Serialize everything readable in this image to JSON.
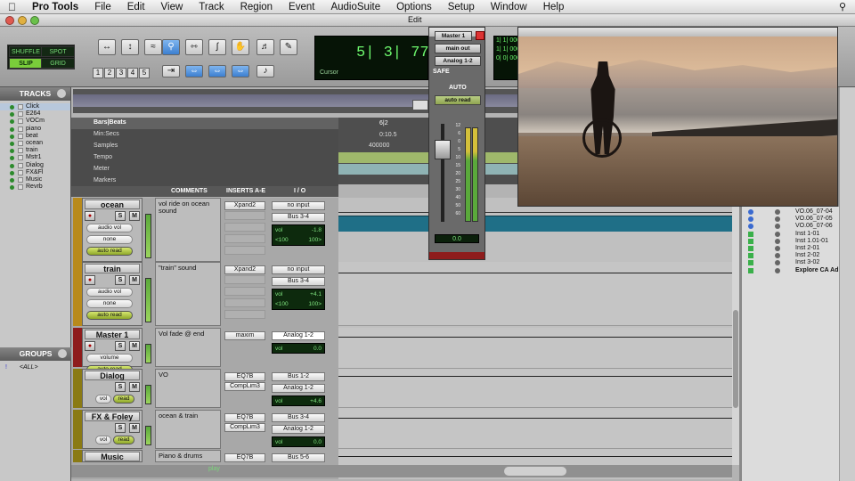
{
  "menubar": {
    "app": "Pro Tools",
    "items": [
      "File",
      "Edit",
      "View",
      "Track",
      "Region",
      "Event",
      "AudioSuite",
      "Options",
      "Setup",
      "Window",
      "Help"
    ]
  },
  "window": {
    "edit_title": "Edit"
  },
  "modes": {
    "shuffle": "SHUFFLE",
    "spot": "SPOT",
    "slip": "SLIP",
    "grid": "GRID"
  },
  "zoom_presets": [
    "1",
    "2",
    "3",
    "4",
    "5"
  ],
  "counter": {
    "main": "5| 3| 774",
    "label": "Cursor",
    "mini1": "1| 1| 000",
    "mini2": "1| 1| 000",
    "mini3": "0| 0| 000"
  },
  "tracks_panel": {
    "header": "TRACKS",
    "items": [
      "Click",
      "E264",
      "VOCm",
      "piano",
      "beat",
      "ocean",
      "train",
      "Mstr1",
      "Dialog",
      "FX&Fl",
      "Music",
      "Revrb"
    ]
  },
  "groups_panel": {
    "header": "GROUPS",
    "item": "<ALL>",
    "marker": "!"
  },
  "rulers": {
    "barsbeats": "Bars|Beats",
    "barsbeats_val": "6|2",
    "minsecs": "Min:Secs",
    "minsecs_val": "0:10.5",
    "samples": "Samples",
    "samples_val": "400000",
    "tempo": "Tempo",
    "meter": "Meter",
    "markers": "Markers"
  },
  "columns": {
    "comments": "COMMENTS",
    "inserts": "INSERTS A-E",
    "io": "I / O"
  },
  "strips": [
    {
      "name": "ocean",
      "automation": "audio vol",
      "group": "none",
      "mode": "auto read",
      "comment": "vol ride on ocean sound",
      "inserts": [
        "Xpand2"
      ],
      "input": "no input",
      "output": "Bus 3-4",
      "vol": "vol",
      "vol_val": "-1.8",
      "pan_l": "<100",
      "pan_r": "100>"
    },
    {
      "name": "train",
      "automation": "audio vol",
      "group": "none",
      "mode": "auto read",
      "comment": "\"train\" sound",
      "inserts": [
        "Xpand2"
      ],
      "input": "no input",
      "output": "Bus 3-4",
      "vol": "vol",
      "vol_val": "+4.1",
      "pan_l": "<100",
      "pan_r": "100>"
    },
    {
      "name": "Master 1",
      "automation": "volume",
      "mode": "auto read",
      "comment": "Vol fade @ end",
      "inserts": [
        "maxim"
      ],
      "output": "Analog 1-2",
      "vol": "vol",
      "vol_val": "0.0"
    },
    {
      "name": "Dialog",
      "vol": "vol",
      "mode": "read",
      "comment": "VO",
      "inserts": [
        "EQ7B",
        "CompLim3"
      ],
      "input": "Bus 1-2",
      "output": "Analog 1-2",
      "vol_val": "+4.6",
      "pan": "P"
    },
    {
      "name": "FX & Foley",
      "vol": "vol",
      "mode": "read",
      "comment": "ocean & train",
      "inserts": [
        "EQ7B",
        "CompLim3"
      ],
      "input": "Bus 3-4",
      "output": "Analog 1-2",
      "vol_val": "0.0",
      "pan": "P"
    },
    {
      "name": "Music",
      "comment": "Piano & drums",
      "inserts": [
        "EQ7B"
      ],
      "input": "Bus 5-6"
    }
  ],
  "buttons": {
    "s": "S",
    "m": "M"
  },
  "status": {
    "play": "play"
  },
  "mixer": {
    "name": "Master 1",
    "out": "main out",
    "analog": "Analog 1-2",
    "safe": "SAFE",
    "auto": "AUTO",
    "auto_mode": "auto read",
    "value": "0.0",
    "scale": [
      "12",
      "6",
      "0",
      "5",
      "10",
      "15",
      "20",
      "25",
      "30",
      "40",
      "50",
      "60"
    ]
  },
  "clips": [
    {
      "label": "VO.06_07-04",
      "kind": "vo"
    },
    {
      "label": "VO.06_07-05",
      "kind": "vo"
    },
    {
      "label": "VO.06_07-06",
      "kind": "vo"
    },
    {
      "label": "Inst 1-01",
      "kind": "inst"
    },
    {
      "label": "Inst 1.01-01",
      "kind": "inst"
    },
    {
      "label": "Inst 2-01",
      "kind": "inst"
    },
    {
      "label": "Inst 2-02",
      "kind": "inst"
    },
    {
      "label": "Inst 3-02",
      "kind": "inst"
    },
    {
      "label": "Explore CA Ad",
      "kind": "movie"
    }
  ],
  "colors": {
    "accent_blue": "#3c7fd0",
    "teal_region": "#1f6f87",
    "green_meter": "#5aa93b",
    "counter_green": "#6cf56c"
  },
  "icons": [
    "apple-icon",
    "search-icon",
    "trim-icon",
    "grabber-icon",
    "hand-icon",
    "scrub-icon",
    "pencil-icon",
    "speaker-icon",
    "clock-icon",
    "cog-icon"
  ]
}
